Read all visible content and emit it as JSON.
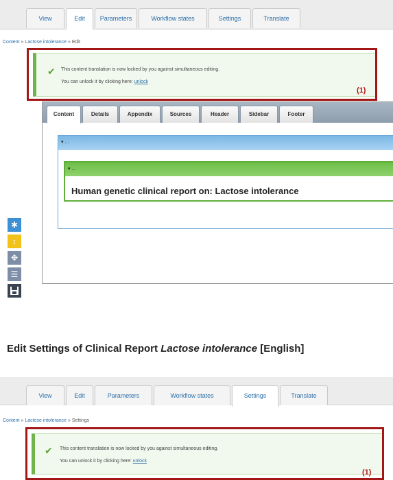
{
  "top_tabs": {
    "items": [
      {
        "label": "View"
      },
      {
        "label": "Edit"
      },
      {
        "label": "Parameters"
      },
      {
        "label": "Workflow states"
      },
      {
        "label": "Settings"
      },
      {
        "label": "Translate"
      }
    ],
    "active": "Edit"
  },
  "breadcrumb1": {
    "link1": "Content",
    "sep1": " » ",
    "link2": "Lactose intolerance",
    "sep2": " » ",
    "current": "Edit"
  },
  "message1": {
    "line1": "This content translation is now locked by you against simultaneous editing.",
    "line2_prefix": "You can unlock it by clicking here: ",
    "unlock": "unlock",
    "annotation": "(1)"
  },
  "editor": {
    "tabs": [
      {
        "label": "Content"
      },
      {
        "label": "Details"
      },
      {
        "label": "Appendix"
      },
      {
        "label": "Sources"
      },
      {
        "label": "Header"
      },
      {
        "label": "Sidebar"
      },
      {
        "label": "Footer"
      }
    ],
    "active": "Content",
    "outer_block_marker": "▾ ...",
    "inner_block_marker": "▾ ...",
    "report_title": "Human genetic clinical report on: Lactose intolerance"
  },
  "toolbar": {
    "buttons": [
      {
        "icon": "asterisk-icon",
        "color": "#3d8fd6"
      },
      {
        "icon": "resize-vertical-icon",
        "color": "#f2c21b"
      },
      {
        "icon": "move-icon",
        "color": "#7d8ea6"
      },
      {
        "icon": "list-icon",
        "color": "#7d8ea6"
      },
      {
        "icon": "save-icon",
        "color": "#3a4350"
      }
    ]
  },
  "settings_page": {
    "title_prefix": "Edit Settings of Clinical Report ",
    "title_italic": "Lactose intolerance",
    "title_suffix": " [English]"
  },
  "bottom_tabs": {
    "items": [
      {
        "label": "View"
      },
      {
        "label": "Edit"
      },
      {
        "label": "Parameters"
      },
      {
        "label": "Workflow states"
      },
      {
        "label": "Settings"
      },
      {
        "label": "Translate"
      }
    ],
    "active": "Settings"
  },
  "breadcrumb2": {
    "link1": "Content",
    "sep1": " » ",
    "link2": "Lactose intolerance",
    "sep2": " » ",
    "current": "Settings"
  },
  "message2": {
    "line1": "This content translation is now locked by you against simultaneous editing.",
    "line2_prefix": "You can unlock it by clicking here: ",
    "unlock": "unlock",
    "annotation": "(1)"
  },
  "colors": {
    "accent_red": "#a31616",
    "success_green": "#70b34a",
    "link_blue": "#2a6fa8"
  }
}
